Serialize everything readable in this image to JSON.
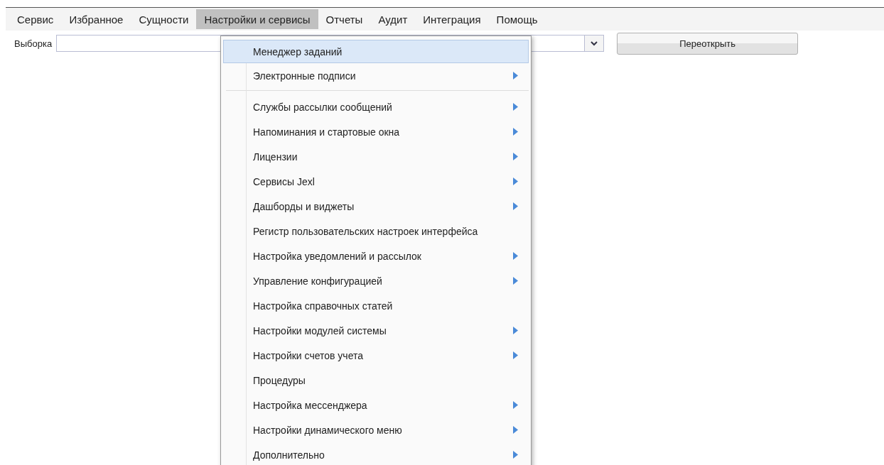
{
  "menubar": [
    {
      "label": "Сервис",
      "selected": false
    },
    {
      "label": "Избранное",
      "selected": false
    },
    {
      "label": "Сущности",
      "selected": false
    },
    {
      "label": "Настройки и сервисы",
      "selected": true
    },
    {
      "label": "Отчеты",
      "selected": false
    },
    {
      "label": "Аудит",
      "selected": false
    },
    {
      "label": "Интеграция",
      "selected": false
    },
    {
      "label": "Помощь",
      "selected": false
    }
  ],
  "toolbar": {
    "label": "Выборка",
    "button": "Переоткрыть"
  },
  "menu": [
    {
      "kind": "item",
      "label": "Менеджер заданий",
      "submenu": false,
      "selected": true
    },
    {
      "kind": "item",
      "label": "Электронные подписи",
      "submenu": true,
      "selected": false
    },
    {
      "kind": "separator"
    },
    {
      "kind": "item",
      "label": "Службы рассылки сообщений",
      "submenu": true,
      "selected": false
    },
    {
      "kind": "item",
      "label": "Напоминания и стартовые окна",
      "submenu": true,
      "selected": false
    },
    {
      "kind": "item",
      "label": "Лицензии",
      "submenu": true,
      "selected": false
    },
    {
      "kind": "item",
      "label": "Сервисы Jexl",
      "submenu": true,
      "selected": false
    },
    {
      "kind": "item",
      "label": "Дашборды и виджеты",
      "submenu": true,
      "selected": false
    },
    {
      "kind": "item",
      "label": "Регистр пользовательских настроек интерфейса",
      "submenu": false,
      "selected": false
    },
    {
      "kind": "item",
      "label": "Настройка уведомлений и рассылок",
      "submenu": true,
      "selected": false
    },
    {
      "kind": "item",
      "label": "Управление конфигурацией",
      "submenu": true,
      "selected": false
    },
    {
      "kind": "item",
      "label": "Настройка справочных статей",
      "submenu": false,
      "selected": false
    },
    {
      "kind": "item",
      "label": "Настройки модулей системы",
      "submenu": true,
      "selected": false
    },
    {
      "kind": "item",
      "label": "Настройки счетов учета",
      "submenu": true,
      "selected": false
    },
    {
      "kind": "item",
      "label": "Процедуры",
      "submenu": false,
      "selected": false
    },
    {
      "kind": "item",
      "label": "Настройка мессенджера",
      "submenu": true,
      "selected": false
    },
    {
      "kind": "item",
      "label": "Настройки динамического меню",
      "submenu": true,
      "selected": false
    },
    {
      "kind": "item",
      "label": "Дополнительно",
      "submenu": true,
      "selected": false
    }
  ]
}
